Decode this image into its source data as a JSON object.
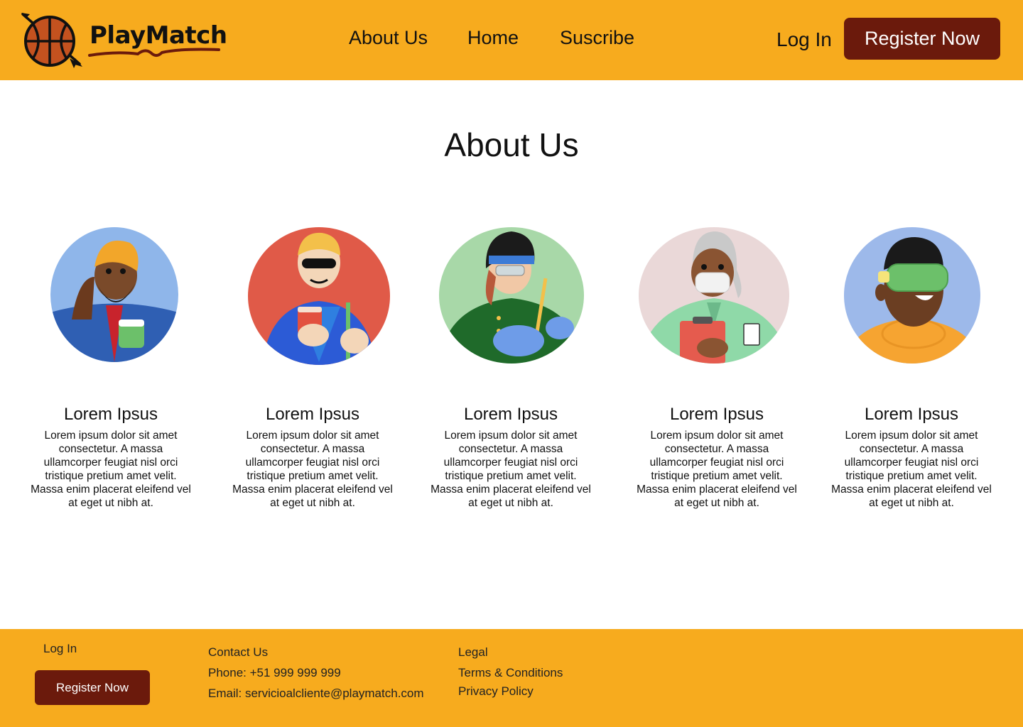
{
  "header": {
    "brand": "PlayMatch",
    "nav": [
      "About Us",
      "Home",
      "Suscribe"
    ],
    "login_label": "Log In",
    "register_label": "Register Now",
    "brand_color": "#F7AB1E",
    "accent_color": "#6B1A0C"
  },
  "main": {
    "title": "About Us",
    "members": [
      {
        "name": "Lorem Ipsus",
        "description": "Lorem ipsum dolor sit amet consectetur. A massa ullamcorper feugiat nisl orci tristique pretium amet velit. Massa enim placerat eleifend vel at eget ut nibh at.",
        "avatar": "man-turban-phone-coffee"
      },
      {
        "name": "Lorem Ipsus",
        "description": "Lorem ipsum dolor sit amet consectetur. A massa ullamcorper feugiat nisl orci tristique pretium amet velit. Massa enim placerat eleifend vel at eget ut nibh at.",
        "avatar": "man-sunglasses-coffee"
      },
      {
        "name": "Lorem Ipsus",
        "description": "Lorem ipsum dolor sit amet consectetur. A massa ullamcorper feugiat nisl orci tristique pretium amet velit. Massa enim placerat eleifend vel at eget ut nibh at.",
        "avatar": "welder-with-torch"
      },
      {
        "name": "Lorem Ipsus",
        "description": "Lorem ipsum dolor sit amet consectetur. A massa ullamcorper feugiat nisl orci tristique pretium amet velit. Massa enim placerat eleifend vel at eget ut nibh at.",
        "avatar": "nurse-with-clipboard"
      },
      {
        "name": "Lorem Ipsus",
        "description": "Lorem ipsum dolor sit amet consectetur. A massa ullamcorper feugiat nisl orci tristique pretium amet velit. Massa enim placerat eleifend vel at eget ut nibh at.",
        "avatar": "man-vr-headset"
      }
    ]
  },
  "footer": {
    "login_label": "Log In",
    "register_label": "Register Now",
    "contact_title": "Contact Us",
    "phone": "Phone: +51 999 999 999",
    "email": "Email: servicioalcliente@playmatch.com",
    "legal_title": "Legal",
    "terms": "Terms & Conditions",
    "privacy": "Privacy Policy"
  }
}
